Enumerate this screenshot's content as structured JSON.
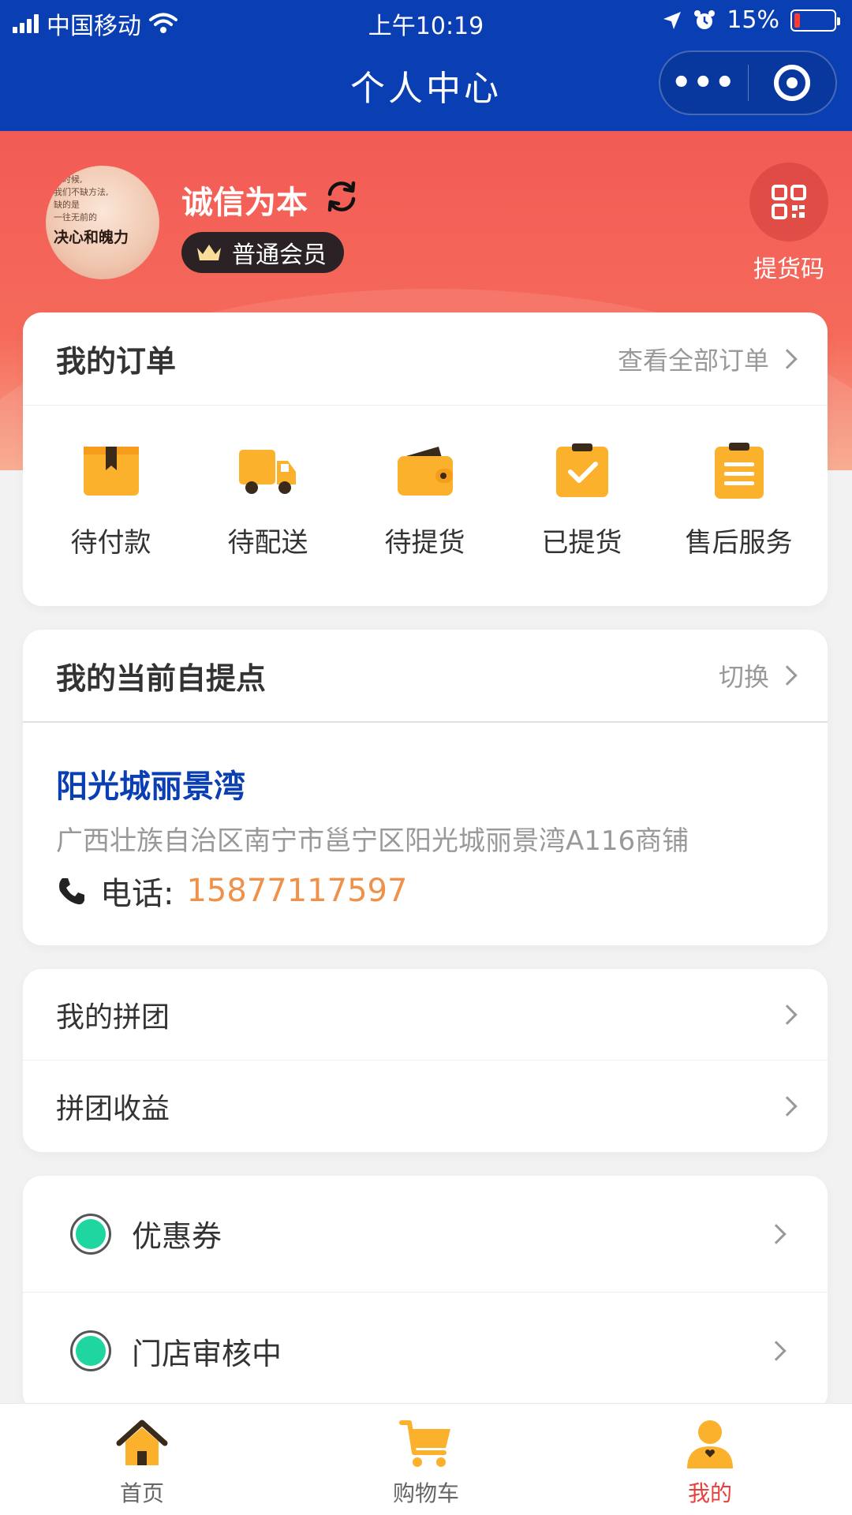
{
  "status_bar": {
    "carrier": "中国移动",
    "time": "上午10:19",
    "battery": "15%"
  },
  "nav": {
    "title": "个人中心",
    "more_label": "•••"
  },
  "profile": {
    "username": "诚信为本",
    "member_level": "普通会员",
    "avatar_quote_lines": [
      "那时候,",
      "我们不缺方法,",
      "缺的是",
      "一往无前的"
    ],
    "avatar_big_text": "决心和魄力",
    "pickup_code_label": "提货码"
  },
  "orders": {
    "title": "我的订单",
    "view_all": "查看全部订单",
    "items": [
      {
        "label": "待付款",
        "icon": "box-icon"
      },
      {
        "label": "待配送",
        "icon": "truck-icon"
      },
      {
        "label": "待提货",
        "icon": "wallet-icon"
      },
      {
        "label": "已提货",
        "icon": "clipboard-check-icon"
      },
      {
        "label": "售后服务",
        "icon": "clipboard-list-icon"
      }
    ]
  },
  "pickup_point": {
    "title": "我的当前自提点",
    "switch_label": "切换",
    "store_name": "阳光城丽景湾",
    "address": "广西壮族自治区南宁市邕宁区阳光城丽景湾A116商铺",
    "phone_label": "电话:",
    "phone": "15877117597"
  },
  "group_buy": {
    "items": [
      "我的拼团",
      "拼团收益"
    ]
  },
  "misc": {
    "items": [
      "优惠券",
      "门店审核中"
    ]
  },
  "tabbar": {
    "items": [
      {
        "label": "首页",
        "icon": "home-icon"
      },
      {
        "label": "购物车",
        "icon": "cart-icon"
      },
      {
        "label": "我的",
        "icon": "user-icon"
      }
    ]
  },
  "colors": {
    "nav_blue": "#0a3fb4",
    "hero_red": "#f25b55",
    "icon_yellow": "#fbb12b",
    "phone_orange": "#f0914a",
    "active_tab": "#e8403b",
    "status_green": "#1fd6a0"
  }
}
